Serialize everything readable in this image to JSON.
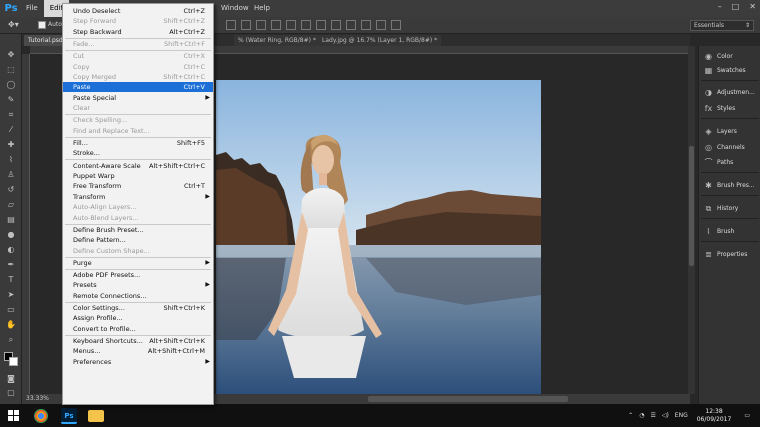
{
  "menubar": {
    "logo": "Ps",
    "items": [
      "File",
      "Edit",
      "Window",
      "Help"
    ]
  },
  "options_bar": {
    "auto_label": "Auto",
    "workspace": "Essentials"
  },
  "tabs": [
    "Tutorial.psd",
    "% (Water Ring, RGB/8#) *",
    "Lady.jpg @ 16.7% (Layer 1, RGB/8#) *"
  ],
  "status": {
    "zoom": "33.33%"
  },
  "edit_menu": {
    "groups": [
      [
        {
          "label": "Undo Deselect",
          "shortcut": "Ctrl+Z",
          "disabled": false
        },
        {
          "label": "Step Forward",
          "shortcut": "Shift+Ctrl+Z",
          "disabled": true
        },
        {
          "label": "Step Backward",
          "shortcut": "Alt+Ctrl+Z",
          "disabled": false
        }
      ],
      [
        {
          "label": "Fade...",
          "shortcut": "Shift+Ctrl+F",
          "disabled": true
        }
      ],
      [
        {
          "label": "Cut",
          "shortcut": "Ctrl+X",
          "disabled": true
        },
        {
          "label": "Copy",
          "shortcut": "Ctrl+C",
          "disabled": true
        },
        {
          "label": "Copy Merged",
          "shortcut": "Shift+Ctrl+C",
          "disabled": true
        },
        {
          "label": "Paste",
          "shortcut": "Ctrl+V",
          "disabled": false,
          "highlight": true
        },
        {
          "label": "Paste Special",
          "shortcut": "",
          "disabled": false,
          "submenu": true
        },
        {
          "label": "Clear",
          "shortcut": "",
          "disabled": true
        }
      ],
      [
        {
          "label": "Check Spelling...",
          "shortcut": "",
          "disabled": true
        },
        {
          "label": "Find and Replace Text...",
          "shortcut": "",
          "disabled": true
        }
      ],
      [
        {
          "label": "Fill...",
          "shortcut": "Shift+F5",
          "disabled": false
        },
        {
          "label": "Stroke...",
          "shortcut": "",
          "disabled": false
        }
      ],
      [
        {
          "label": "Content-Aware Scale",
          "shortcut": "Alt+Shift+Ctrl+C",
          "disabled": false
        },
        {
          "label": "Puppet Warp",
          "shortcut": "",
          "disabled": false
        },
        {
          "label": "Free Transform",
          "shortcut": "Ctrl+T",
          "disabled": false
        },
        {
          "label": "Transform",
          "shortcut": "",
          "disabled": false,
          "submenu": true
        },
        {
          "label": "Auto-Align Layers...",
          "shortcut": "",
          "disabled": true
        },
        {
          "label": "Auto-Blend Layers...",
          "shortcut": "",
          "disabled": true
        }
      ],
      [
        {
          "label": "Define Brush Preset...",
          "shortcut": "",
          "disabled": false
        },
        {
          "label": "Define Pattern...",
          "shortcut": "",
          "disabled": false
        },
        {
          "label": "Define Custom Shape...",
          "shortcut": "",
          "disabled": true
        }
      ],
      [
        {
          "label": "Purge",
          "shortcut": "",
          "disabled": false,
          "submenu": true
        }
      ],
      [
        {
          "label": "Adobe PDF Presets...",
          "shortcut": "",
          "disabled": false
        },
        {
          "label": "Presets",
          "shortcut": "",
          "disabled": false,
          "submenu": true
        },
        {
          "label": "Remote Connections...",
          "shortcut": "",
          "disabled": false
        }
      ],
      [
        {
          "label": "Color Settings...",
          "shortcut": "Shift+Ctrl+K",
          "disabled": false
        },
        {
          "label": "Assign Profile...",
          "shortcut": "",
          "disabled": false
        },
        {
          "label": "Convert to Profile...",
          "shortcut": "",
          "disabled": false
        }
      ],
      [
        {
          "label": "Keyboard Shortcuts...",
          "shortcut": "Alt+Shift+Ctrl+K",
          "disabled": false
        },
        {
          "label": "Menus...",
          "shortcut": "Alt+Shift+Ctrl+M",
          "disabled": false
        },
        {
          "label": "Preferences",
          "shortcut": "",
          "disabled": false,
          "submenu": true
        }
      ]
    ]
  },
  "panels": [
    {
      "label": "Color",
      "icon": "color-wheel-icon"
    },
    {
      "label": "Swatches",
      "icon": "swatches-icon"
    },
    {
      "label": "Adjustmen...",
      "icon": "adjustments-icon"
    },
    {
      "label": "Styles",
      "icon": "styles-icon"
    },
    {
      "label": "Layers",
      "icon": "layers-icon"
    },
    {
      "label": "Channels",
      "icon": "channels-icon"
    },
    {
      "label": "Paths",
      "icon": "paths-icon"
    },
    {
      "label": "Brush Pres...",
      "icon": "brush-presets-icon"
    },
    {
      "label": "History",
      "icon": "history-icon"
    },
    {
      "label": "Brush",
      "icon": "brush-icon"
    },
    {
      "label": "Properties",
      "icon": "properties-icon"
    }
  ],
  "taskbar": {
    "tray_lang": "ENG",
    "time": "12:38",
    "date": "06/09/2017"
  }
}
